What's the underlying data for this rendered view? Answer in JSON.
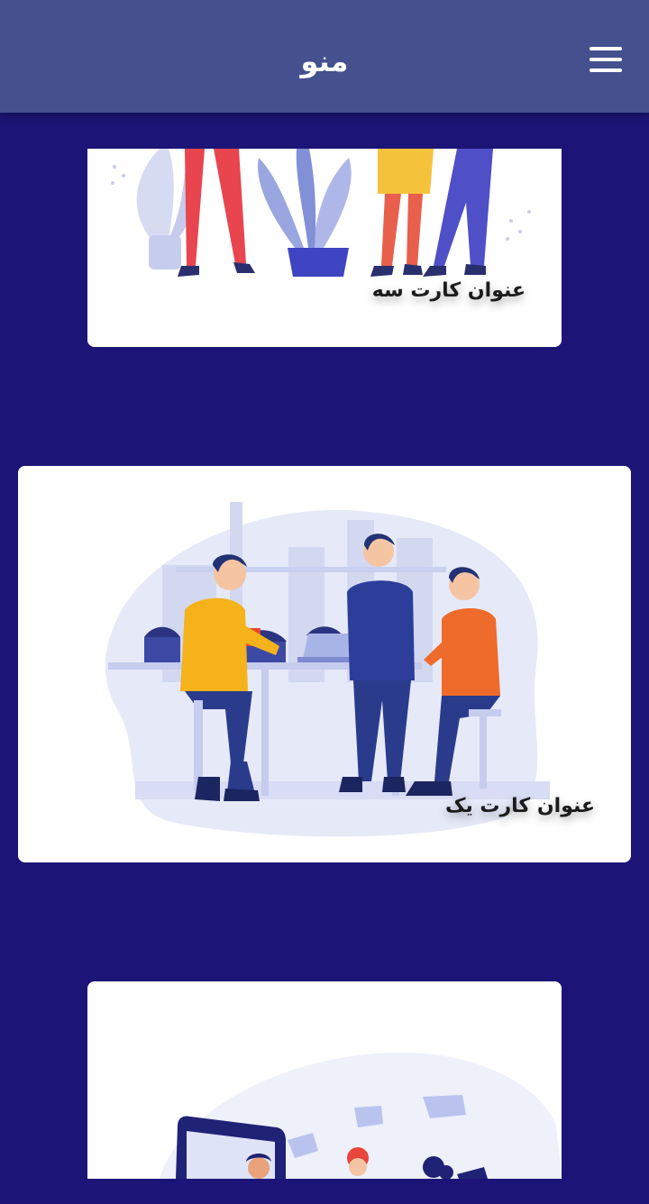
{
  "appbar": {
    "title": "منو",
    "menu_icon": "hamburger-menu-icon"
  },
  "cards": [
    {
      "title": "عنوان کارت سه",
      "illustration": "people-with-plants-illustration"
    },
    {
      "title": "عنوان کارت یک",
      "illustration": "team-meeting-illustration"
    },
    {
      "title": "",
      "illustration": "social-media-phone-illustration"
    }
  ],
  "colors": {
    "page_background": "#1c1577",
    "appbar_background": "#45508f",
    "card_background": "#ffffff"
  }
}
